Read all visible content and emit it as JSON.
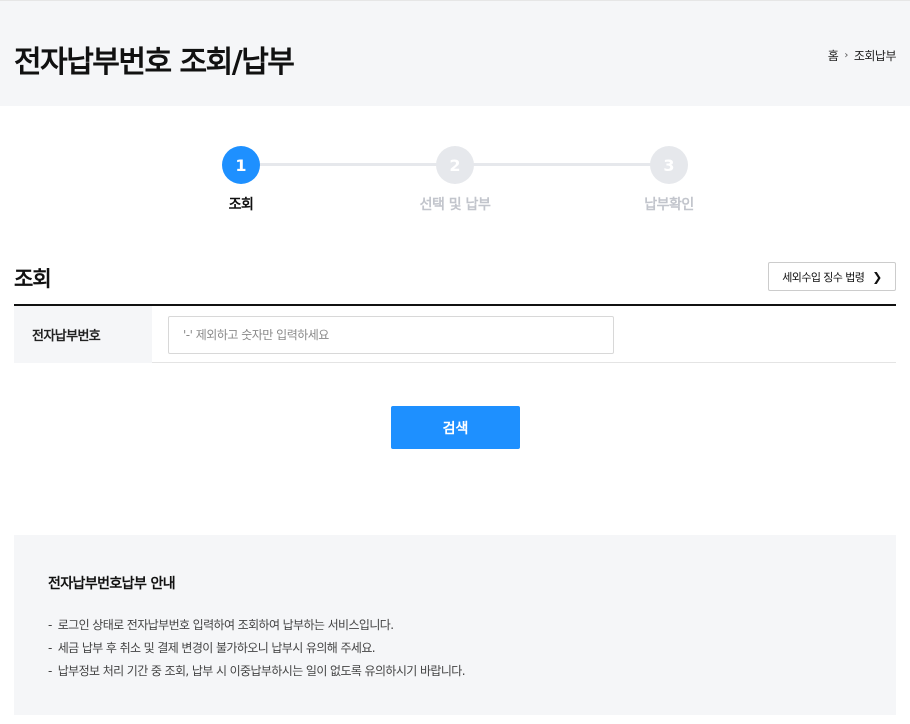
{
  "header": {
    "title": "전자납부번호 조회/납부",
    "breadcrumb": [
      "홈",
      "조회납부"
    ]
  },
  "stepper": {
    "current": 1,
    "steps": [
      {
        "number": "1",
        "label": "조회"
      },
      {
        "number": "2",
        "label": "선택 및 납부"
      },
      {
        "number": "3",
        "label": "납부확인"
      }
    ]
  },
  "section": {
    "title": "조회",
    "rule_button": "세외수입 징수 법령"
  },
  "form": {
    "label": "전자납부번호",
    "placeholder": "'-' 제외하고 숫자만 입력하세요",
    "value": ""
  },
  "search_button": "검색",
  "guide": {
    "title": "전자납부번호납부 안내",
    "items": [
      "로그인 상태로 전자납부번호 입력하여 조회하여 납부하는 서비스입니다.",
      "세금 납부 후 취소 및 결제 변경이 불가하오니 납부시 유의해 주세요.",
      "납부정보 처리 기간 중 조회, 납부 시 이중납부하시는 일이 없도록 유의하시기 바랍니다."
    ]
  },
  "colors": {
    "accent": "#1e90ff",
    "inactive_step": "#e6e8ec",
    "panel_bg": "#f5f6f8"
  }
}
